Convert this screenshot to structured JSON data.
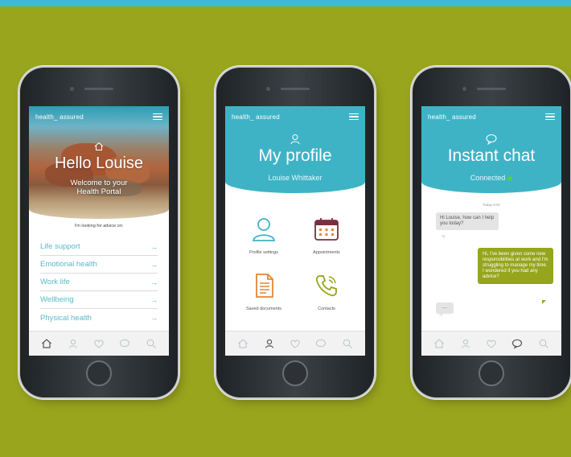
{
  "brand": "health_ assured",
  "colors": {
    "teal": "#3fb3c6",
    "olive": "#95a51c",
    "accent_text": "#5bb8c9",
    "background": "#9aa51e"
  },
  "screen1": {
    "title": "Hello Louise",
    "welcome_line1": "Welcome to your",
    "welcome_line2": "Health Portal",
    "advice_prompt": "I'm looking for advice on:",
    "items": [
      {
        "label": "Life support"
      },
      {
        "label": "Emotional health"
      },
      {
        "label": "Work life"
      },
      {
        "label": "Wellbeing"
      },
      {
        "label": "Physical health"
      }
    ],
    "arrow": "→"
  },
  "screen2": {
    "title": "My profile",
    "user_name": "Louise Whittaker",
    "tiles": {
      "profile": "Profile settings",
      "appointments": "Appointments",
      "documents": "Saved documents",
      "contacts": "Contacts"
    }
  },
  "screen3": {
    "title": "Instant chat",
    "status": "Connected",
    "day_label": "Today 9:01",
    "message_in": "Hi Louise, how can I help you today?",
    "message_out": "Hi, I've been given some new responsibilities at work and I'm struggling to manage my time. I wondered if you had any advice?",
    "typing": "..."
  },
  "tabbar_icons": [
    "home-icon",
    "user-icon",
    "heart-icon",
    "chat-icon",
    "search-icon"
  ]
}
